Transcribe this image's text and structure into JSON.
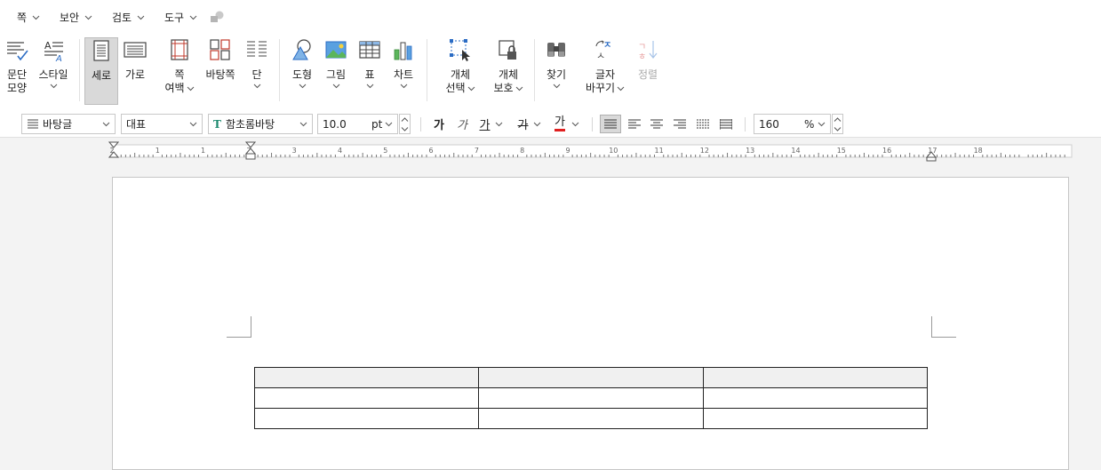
{
  "menu": {
    "items": [
      {
        "label": "쪽"
      },
      {
        "label": "보안"
      },
      {
        "label": "검토"
      },
      {
        "label": "도구"
      }
    ]
  },
  "ribbon": {
    "paragraph_shape": [
      "문단",
      "모양"
    ],
    "style": "스타일",
    "portrait": "세로",
    "landscape": "가로",
    "page_margin": [
      "쪽",
      "여백"
    ],
    "master_page": "바탕쪽",
    "columns": "단",
    "shape": "도형",
    "picture": "그림",
    "table": "표",
    "chart": "차트",
    "object_select": [
      "개체",
      "선택"
    ],
    "object_protect": [
      "개체",
      "보호"
    ],
    "find": "찾기",
    "replace": [
      "글자",
      "바꾸기"
    ],
    "sort": "정렬"
  },
  "format": {
    "para_style": "바탕글",
    "lang": "대표",
    "font": "함초롬바탕",
    "font_icon": "T",
    "font_size": "10.0",
    "size_unit": "pt",
    "bold_glyph": "가",
    "italic_glyph": "가",
    "underline_glyph": "가",
    "strike_glyph": "가",
    "color_glyph": "가",
    "zoom": "160",
    "zoom_unit": "%"
  },
  "ruler": {
    "labels": [
      "2",
      "1",
      "1",
      "2",
      "3",
      "4",
      "5",
      "6",
      "7",
      "8",
      "9",
      "10",
      "11",
      "12",
      "13",
      "14",
      "15",
      "16",
      "17",
      "18"
    ]
  },
  "colors": {
    "accent_blue": "#2b6cc4",
    "font_color_red": "#e02020"
  }
}
